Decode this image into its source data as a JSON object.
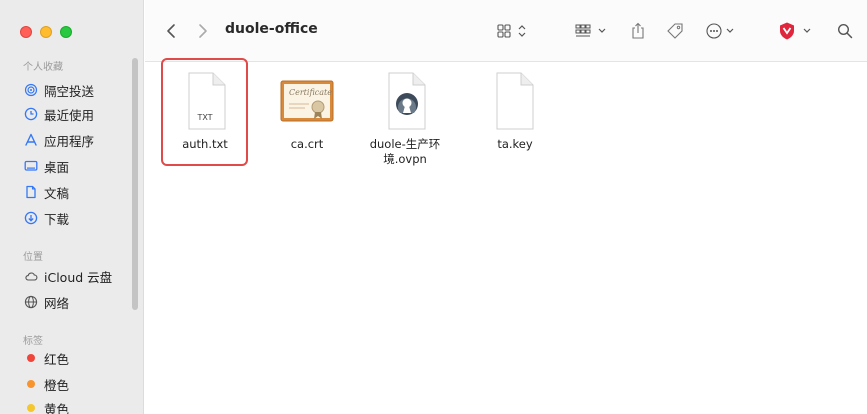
{
  "window": {
    "path_title": "duole-office"
  },
  "sidebar": {
    "favorites_title": "个人收藏",
    "favorites": [
      {
        "label": "隔空投送",
        "icon": "airdrop-icon"
      },
      {
        "label": "最近使用",
        "icon": "clock-icon"
      },
      {
        "label": "应用程序",
        "icon": "applications-icon"
      },
      {
        "label": "桌面",
        "icon": "desktop-icon"
      },
      {
        "label": "文稿",
        "icon": "document-icon"
      },
      {
        "label": "下载",
        "icon": "download-icon"
      }
    ],
    "locations_title": "位置",
    "locations": [
      {
        "label": "iCloud 云盘",
        "icon": "icloud-icon"
      },
      {
        "label": "网络",
        "icon": "network-icon"
      }
    ],
    "tags_title": "标签",
    "tags": [
      {
        "label": "红色",
        "color": "#f0453a"
      },
      {
        "label": "橙色",
        "color": "#f7942f"
      },
      {
        "label": "黄色",
        "color": "#f5c72e"
      }
    ]
  },
  "files": [
    {
      "name": "auth.txt",
      "type": "txt",
      "badge": "TXT",
      "selected": true
    },
    {
      "name": "ca.crt",
      "type": "certificate",
      "cert_text": "Certificate"
    },
    {
      "name": "duole-生产环境.ovpn",
      "type": "ovpn"
    },
    {
      "name": "ta.key",
      "type": "blank"
    }
  ],
  "colors": {
    "selection": "#e04a4a",
    "accent_red": "#e0263d"
  }
}
